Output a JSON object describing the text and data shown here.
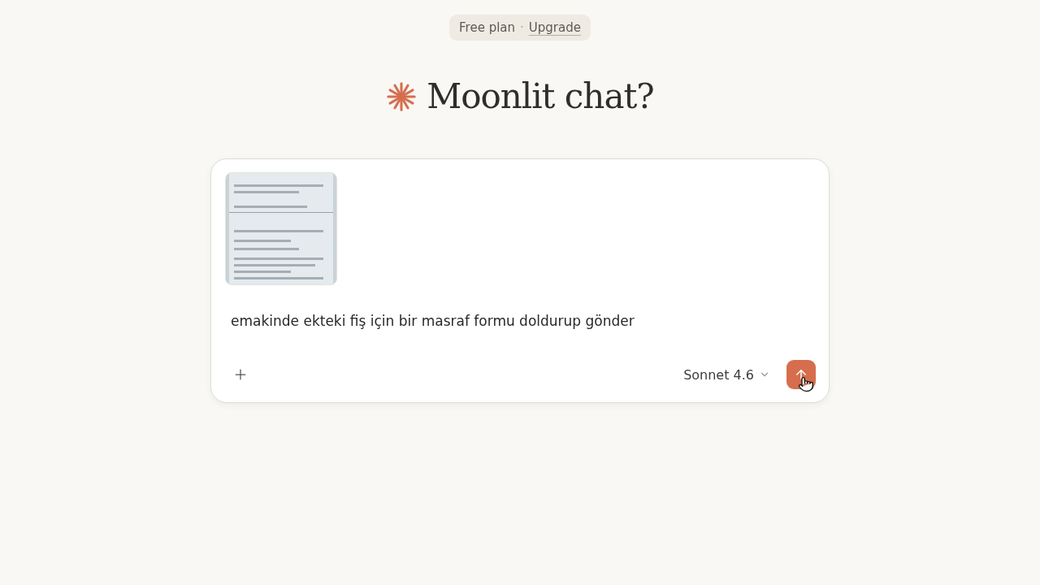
{
  "plan_badge": {
    "plan": "Free plan",
    "separator": "·",
    "link": "Upgrade"
  },
  "heading": {
    "title": "Moonlit chat?"
  },
  "composer": {
    "message": "emakinde ekteki fiş için bir masraf formu doldurup gönder",
    "model": "Sonnet 4.6"
  }
}
